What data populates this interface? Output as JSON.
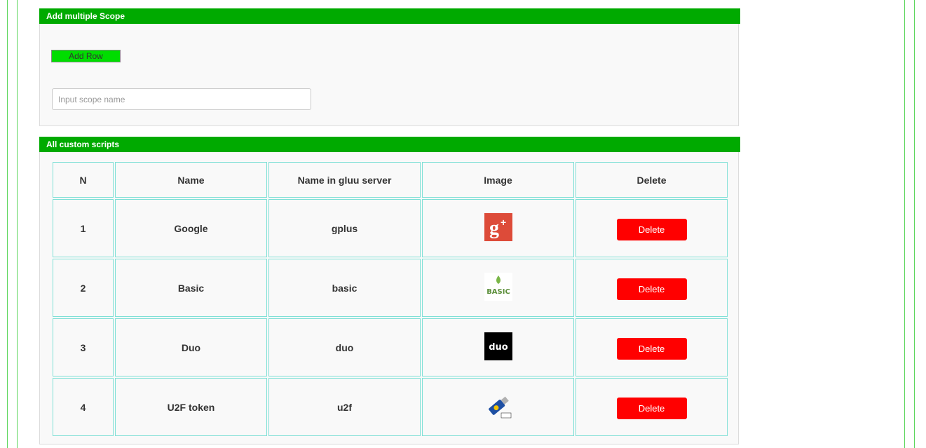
{
  "scope_section": {
    "header": "Add multiple Scope",
    "add_row_label": "Add Row",
    "input_placeholder": "Input scope name",
    "input_value": ""
  },
  "scripts_section": {
    "header": "All custom scripts",
    "columns": [
      "N",
      "Name",
      "Name in gluu server",
      "Image",
      "Delete"
    ],
    "rows": [
      {
        "n": "1",
        "name": "Google",
        "gluu_name": "gplus",
        "image_icon": "google-plus-logo",
        "delete_label": "Delete"
      },
      {
        "n": "2",
        "name": "Basic",
        "gluu_name": "basic",
        "image_icon": "basic-logo",
        "delete_label": "Delete"
      },
      {
        "n": "3",
        "name": "Duo",
        "gluu_name": "duo",
        "image_icon": "duo-logo",
        "delete_label": "Delete"
      },
      {
        "n": "4",
        "name": "U2F token",
        "gluu_name": "u2f",
        "image_icon": "u2f-token-logo",
        "delete_label": "Delete"
      }
    ]
  },
  "colors": {
    "header_green": "#00aa00",
    "button_green": "#00dd00",
    "delete_red": "#ff0000",
    "table_border": "#7fe0d6"
  }
}
